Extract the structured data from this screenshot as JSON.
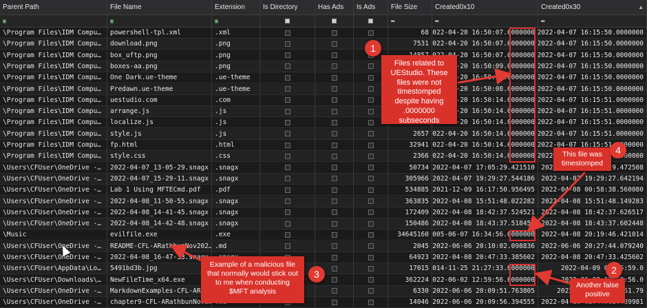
{
  "columns": [
    "Parent Path",
    "File Name",
    "Extension",
    "Is Directory",
    "Has Ads",
    "Is Ads",
    "File Size",
    "Created0x10",
    "Created0x30"
  ],
  "rows": [
    [
      "\\Program Files\\IDM Compu…",
      "powershell-tpl.xml",
      ".xml",
      "",
      "",
      "",
      "68",
      "2022-04-20 16:50:07.0000000",
      "2022-04-07 16:15:50.0000000"
    ],
    [
      "\\Program Files\\IDM Compu…",
      "download.png",
      ".png",
      "",
      "",
      "",
      "7531",
      "2022-04-20 16:50:07.0000000",
      "2022-04-07 16:15:50.0000000"
    ],
    [
      "\\Program Files\\IDM Compu…",
      "box_uftp.png",
      ".png",
      "",
      "",
      "",
      "14857",
      "2022-04-20 16:50:07.0000000",
      "2022-04-07 16:15:50.0000000"
    ],
    [
      "\\Program Files\\IDM Compu…",
      "boxes-aa.png",
      ".png",
      "",
      "",
      "",
      "",
      "2022-04-20 16:50:09.0000000",
      "2022-04-07 16:15:50.0000000"
    ],
    [
      "\\Program Files\\IDM Compu…",
      "One Dark.ue-theme",
      ".ue-theme",
      "",
      "",
      "",
      "",
      "2022-04-20 16:50:08.0000000",
      "2022-04-07 16:15:50.0000000"
    ],
    [
      "\\Program Files\\IDM Compu…",
      "Predawn.ue-theme",
      ".ue-theme",
      "",
      "",
      "",
      "",
      "2022-04-20 16:50:08.0000000",
      "2022-04-07 16:15:50.0000000"
    ],
    [
      "\\Program Files\\IDM Compu…",
      "uestudio.com",
      ".com",
      "",
      "",
      "",
      "",
      "2022-04-20 16:50:14.0000000",
      "2022-04-07 16:15:51.0000000"
    ],
    [
      "\\Program Files\\IDM Compu…",
      "arrange.js",
      ".js",
      "",
      "",
      "",
      "",
      "2022-04-20 16:50:14.0000000",
      "2022-04-07 16:15:51.0000000"
    ],
    [
      "\\Program Files\\IDM Compu…",
      "localize.js",
      ".js",
      "",
      "",
      "",
      "",
      "2022-04-20 16:50:14.0000000",
      "2022-04-07 16:15:51.0000000"
    ],
    [
      "\\Program Files\\IDM Compu…",
      "style.js",
      ".js",
      "",
      "",
      "",
      "2657",
      "2022-04-20 16:50:14.0000000",
      "2022-04-07 16:15:51.0000000"
    ],
    [
      "\\Program Files\\IDM Compu…",
      "fp.html",
      ".html",
      "",
      "",
      "",
      "32941",
      "2022-04-20 16:50:14.0000000",
      "2022-04-07 16:15:51.0000000"
    ],
    [
      "\\Program Files\\IDM Compu…",
      "style.css",
      ".css",
      "",
      "",
      "",
      "2366",
      "2022-04-20 16:50:14.0000000",
      "2022-04-07 16:15:51.0000000"
    ],
    [
      "\\Users\\CFUser\\OneDrive -…",
      "2022-04-07_13-05-29.snagx",
      ".snagx",
      "",
      "",
      "",
      "50734",
      "2022-04-07 17:05:29.421510",
      "2022-04-07 17:05:29.472508"
    ],
    [
      "\\Users\\CFUser\\OneDrive -…",
      "2022-04-07_15-29-11.snagx",
      ".snagx",
      "",
      "",
      "",
      "305966",
      "2022-04-07 19:29:27.544186",
      "2022-04-07 19:29:27.642194"
    ],
    [
      "\\Users\\CFUser\\OneDrive -…",
      "Lab 1 Using MFTECmd.pdf",
      ".pdf",
      "",
      "",
      "",
      "534885",
      "2021-12-09 16:17:50.956495",
      "2022-04-08 00:58:38.560080"
    ],
    [
      "\\Users\\CFUser\\OneDrive -…",
      "2022-04-08_11-50-55.snagx",
      ".snagx",
      "",
      "",
      "",
      "363835",
      "2022-04-08 15:51:48.022282",
      "2022-04-08 15:51:48.149283"
    ],
    [
      "\\Users\\CFUser\\OneDrive -…",
      "2022-04-08_14-41-45.snagx",
      ".snagx",
      "",
      "",
      "",
      "172409",
      "2022-04-08 18:42:37.524521",
      "2022-04-08 18:42:37.626517"
    ],
    [
      "\\Users\\CFUser\\OneDrive -…",
      "2022-04-08_14-42-48.snagx",
      ".snagx",
      "",
      "",
      "",
      "150486",
      "2022-04-08 18:43:37.518451",
      "2022-04-08 18:43:37.602448"
    ],
    [
      "\\Music",
      "evilfile.exe",
      ".exe",
      "",
      "",
      "",
      "34645160",
      "2005-06-07 16:34:56.0000000",
      "2022-04-08 20:19:46.421014"
    ],
    [
      "\\Users\\CFUser\\OneDrive -…",
      "README-CFL-ARathbunNov202…",
      ".md",
      "",
      "",
      "",
      "2045",
      "2022-06-06 20:10:02.098836",
      "2022-06-06 20:27:44.079240"
    ],
    [
      "\\Users\\CFUser\\OneDrive -…",
      "2022-04-08_16-47-33.snagx",
      ".snagx",
      "",
      "",
      "",
      "64923",
      "2022-04-08 20:47:33.385602",
      "2022-04-08 20:47:33.425602"
    ],
    [
      "\\Users\\CFUser\\AppData\\Lo…",
      "5491bd3b.jpg",
      ".jpg",
      "",
      "",
      "",
      "17015",
      "2014-11-25 21:27:33.0000000",
      "2022-04-09 03:35:59.0"
    ],
    [
      "\\Users\\CFUser\\Downloads\\…",
      "NewFileTime_x64.exe",
      ".exe",
      "",
      "",
      "",
      "362224",
      "2022-06-02 12:59:56.0000000",
      "2022-06-02 12:59:56.0"
    ],
    [
      "\\Users\\CFUser\\OneDrive -…",
      "MarkdownExamples-CFL-ARat…",
      ".md",
      "",
      "",
      "",
      "6330",
      "2022-06-06 20:09:51.763805",
      "2022-06-06 20:09:51.79"
    ],
    [
      "\\Users\\CFUser\\OneDrive -…",
      "chapter9-CFL-ARathbunNov2…",
      ".md",
      "",
      "",
      "",
      "14046",
      "2022-06-06 20:09:56.394555",
      "2022-04-10 02:44:02.489981"
    ]
  ],
  "callouts": [
    {
      "num": "1",
      "text": "Files related to UEStudio. These files were not timestomped despite having .0000000 subseconds"
    },
    {
      "num": "2",
      "text": "Another false positive"
    },
    {
      "num": "3",
      "text": "Example of a malicious file that normally would stick out to me when conducting $MFT analysis"
    },
    {
      "num": "4",
      "text": "This file was timestomped"
    }
  ],
  "colors": {
    "highlight": "#e03030",
    "callout": "#d9322b"
  }
}
